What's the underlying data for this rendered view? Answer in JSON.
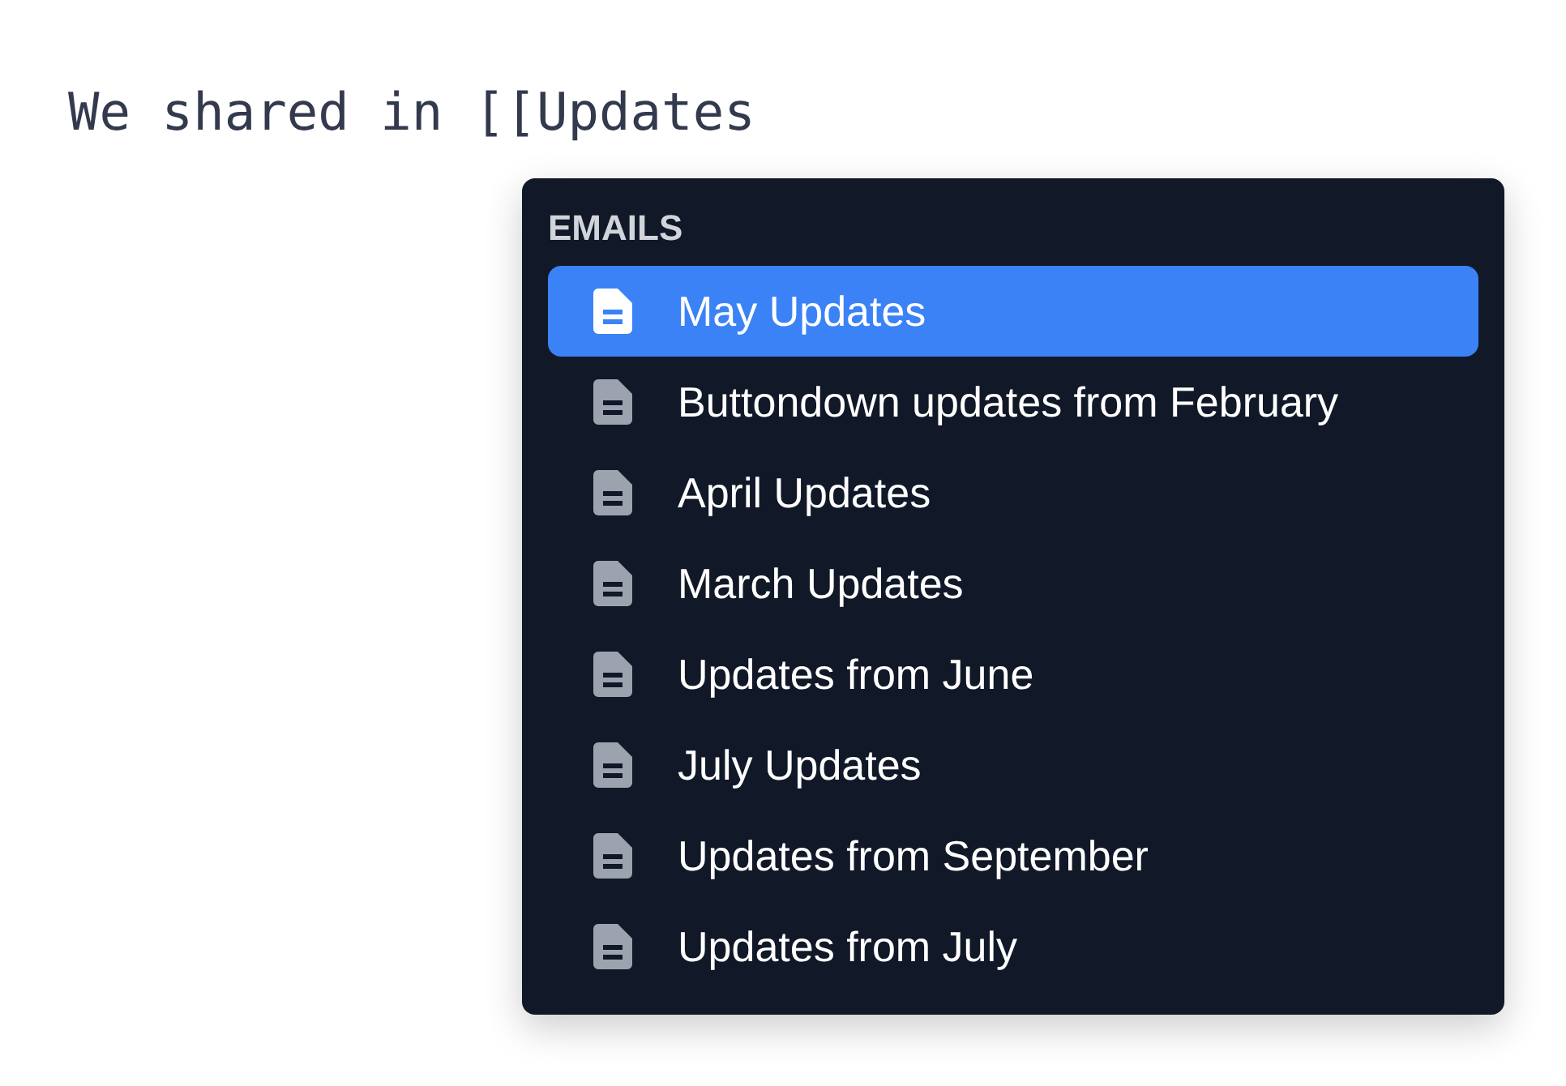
{
  "editor": {
    "text": "We shared in [[Updates"
  },
  "dropdown": {
    "heading": "EMAILS",
    "items": [
      {
        "label": "May Updates",
        "selected": true
      },
      {
        "label": "Buttondown updates from February",
        "selected": false
      },
      {
        "label": "April Updates",
        "selected": false
      },
      {
        "label": "March Updates",
        "selected": false
      },
      {
        "label": "Updates from June",
        "selected": false
      },
      {
        "label": "July Updates",
        "selected": false
      },
      {
        "label": "Updates from September",
        "selected": false
      },
      {
        "label": "Updates from July",
        "selected": false
      }
    ]
  }
}
